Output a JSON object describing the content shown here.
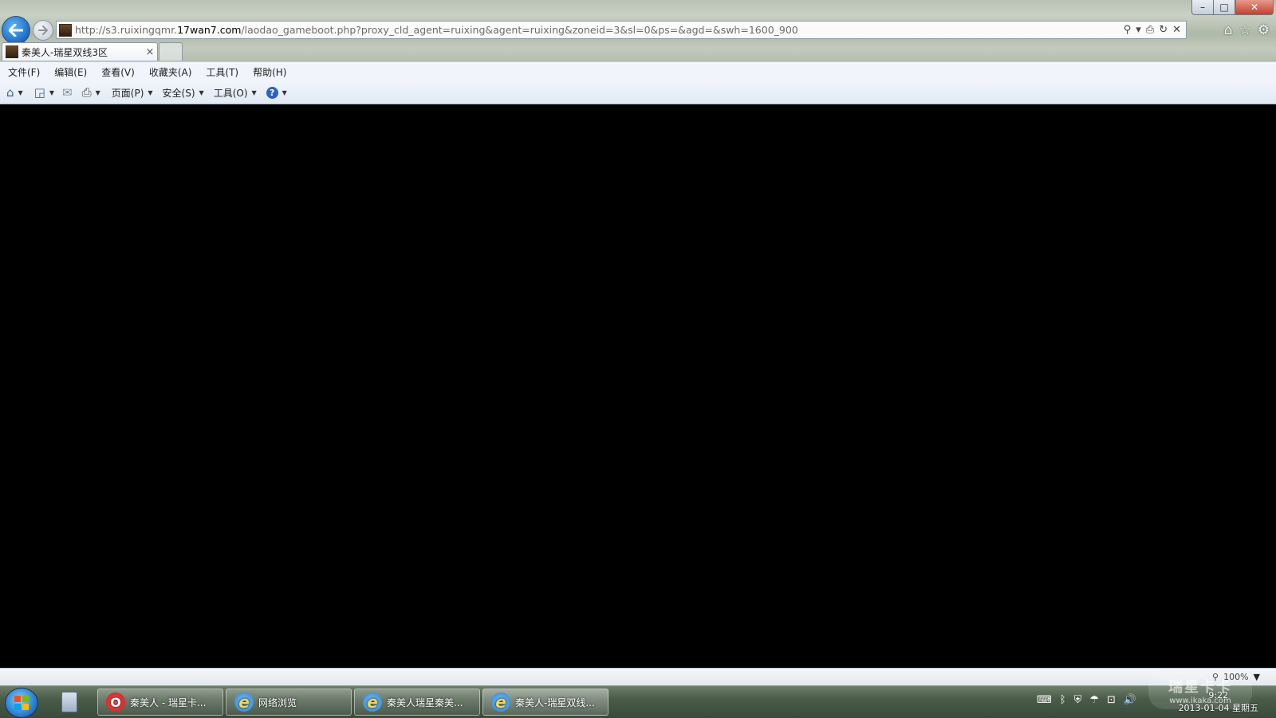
{
  "window": {
    "controls": {
      "minimize": "–",
      "maximize": "□",
      "close": "✕"
    }
  },
  "nav": {
    "back_icon": "back-arrow-icon",
    "forward_icon": "forward-arrow-icon"
  },
  "address": {
    "url_prefix": "http://s3.ruixingqmr.",
    "url_domain": "17wan7.com",
    "url_suffix": "/laodao_gameboot.php?proxy_cld_agent=ruixing&agent=ruixing&zoneid=3&sl=0&ps=&agd=&swh=1600_900",
    "tools": [
      "⚲",
      "▾",
      "⎙",
      "↻",
      "✕"
    ]
  },
  "tabs": [
    {
      "title": "秦美人-瑞星双线3区",
      "close": "×"
    }
  ],
  "right_icons": [
    "⌂",
    "☆",
    "⚙"
  ],
  "menu": [
    "文件(F)",
    "编辑(E)",
    "查看(V)",
    "收藏夹(A)",
    "工具(T)",
    "帮助(H)"
  ],
  "commands": {
    "home": "⌂",
    "feeds": "◲",
    "mail": "✉",
    "print": "⎙",
    "page": "页面(P)",
    "safety": "安全(S)",
    "tools": "工具(O)",
    "help": "?"
  },
  "status": {
    "zoom": "100%",
    "zoom_icon": "magnifier-icon"
  },
  "taskbar": {
    "items": [
      {
        "label": "秦美人 - 瑞星卡...",
        "icon": "opera-icon"
      },
      {
        "label": "网络浏览",
        "icon": "ie-icon"
      },
      {
        "label": "秦美人瑞星秦美...",
        "icon": "ie-icon"
      },
      {
        "label": "秦美人-瑞星双线...",
        "icon": "ie-icon"
      }
    ],
    "tray": [
      "⌨",
      "ᛒ",
      "⛨",
      "☂",
      "⊡",
      "🔊"
    ],
    "time": "9:22",
    "date": "2013-01-04 星期五"
  },
  "watermark": {
    "brand": "瑞星卡卡",
    "site": "www.ikaka.com"
  }
}
